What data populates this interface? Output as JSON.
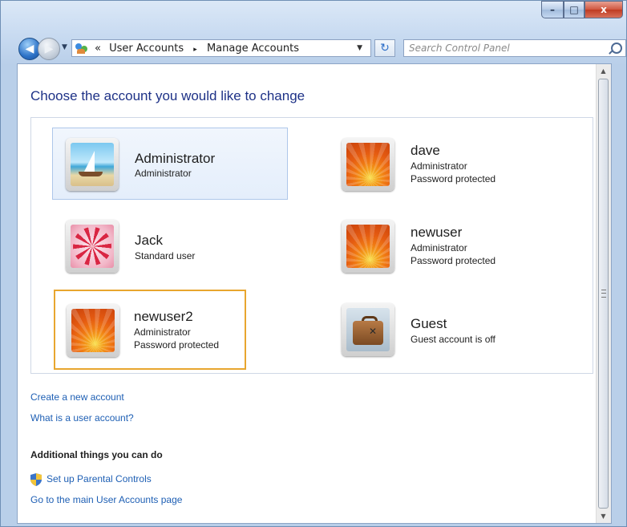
{
  "window": {
    "controls": {
      "minimize": "–",
      "maximize": "□",
      "close": "x"
    }
  },
  "nav": {
    "address_prefix": "«",
    "breadcrumb": [
      "User Accounts",
      "Manage Accounts"
    ],
    "breadcrumb_separator": "▸",
    "search_placeholder": "Search Control Panel"
  },
  "content": {
    "heading": "Choose the account you would like to change",
    "accounts": [
      {
        "name": "Administrator",
        "lines": [
          "Administrator"
        ],
        "picture": "sailboat-picture",
        "state": "hover"
      },
      {
        "name": "dave",
        "lines": [
          "Administrator",
          "Password protected"
        ],
        "picture": "orange-flower-picture",
        "state": "normal"
      },
      {
        "name": "Jack",
        "lines": [
          "Standard user"
        ],
        "picture": "starfish-picture",
        "state": "normal"
      },
      {
        "name": "newuser",
        "lines": [
          "Administrator",
          "Password protected"
        ],
        "picture": "orange-flower-picture",
        "state": "normal"
      },
      {
        "name": "newuser2",
        "lines": [
          "Administrator",
          "Password protected"
        ],
        "picture": "orange-flower-picture",
        "state": "selected"
      },
      {
        "name": "Guest",
        "lines": [
          "Guest account is off"
        ],
        "picture": "suitcase-picture",
        "state": "normal"
      }
    ],
    "links": {
      "create_account": "Create a new account",
      "what_is_account": "What is a user account?"
    },
    "additional": {
      "title": "Additional things you can do",
      "parental_controls": "Set up Parental Controls",
      "main_page": "Go to the main User Accounts page"
    }
  },
  "colors": {
    "heading": "#1e3287",
    "link": "#1e5fb4",
    "selection_border": "#e8a62f",
    "hover_bg": "#e4eefb"
  }
}
